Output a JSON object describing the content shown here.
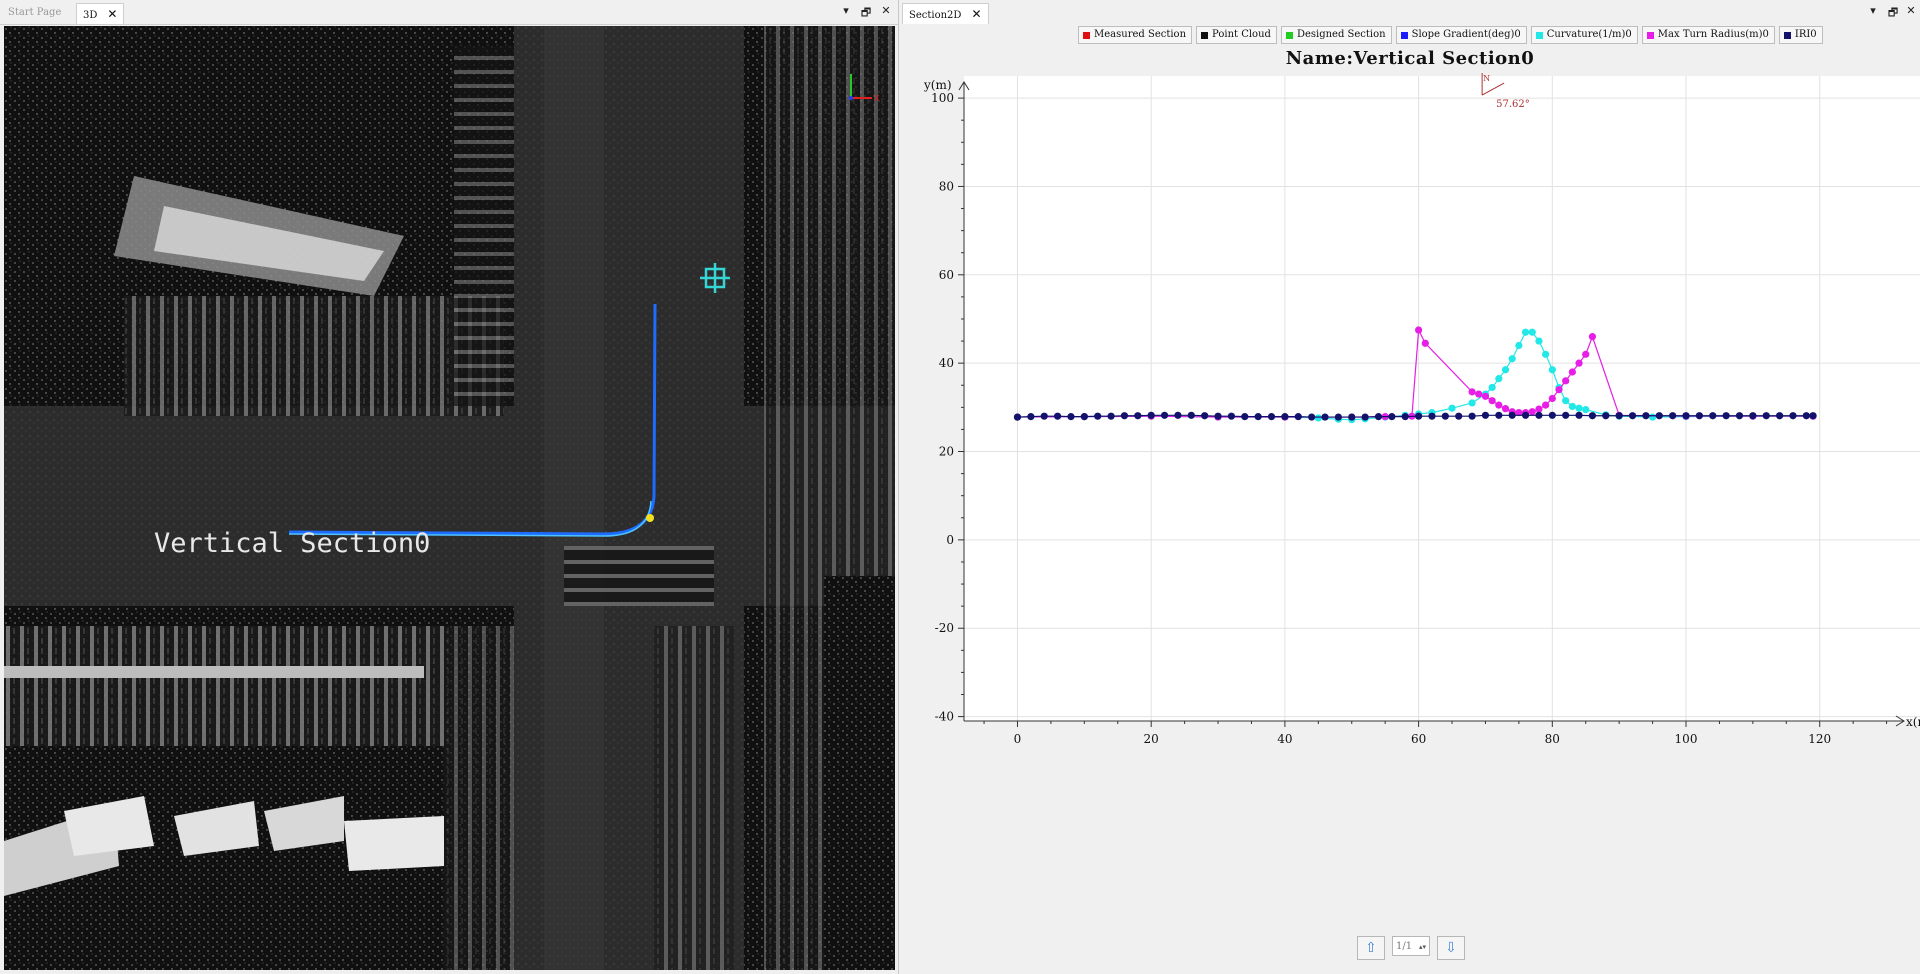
{
  "left_window": {
    "tabs": [
      {
        "label": "Start Page",
        "active": false
      },
      {
        "label": "3D",
        "active": true
      }
    ],
    "controls": {
      "pin": "▾",
      "restore": "🗗",
      "close": "✕"
    },
    "viewport": {
      "section_label": "Vertical Section0",
      "axis_gizmo": {
        "x_label": "X"
      },
      "colors": {
        "section_path": "#1e6cff",
        "crosshair": "#34d6d6",
        "marker": "#f0e020"
      }
    }
  },
  "right_window": {
    "tabs": [
      {
        "label": "Section2D",
        "active": true
      }
    ],
    "controls": {
      "pin": "▾",
      "restore": "🗗",
      "close": "✕"
    },
    "legend": [
      {
        "label": "Measured Section",
        "color": "#e01010"
      },
      {
        "label": "Point Cloud",
        "color": "#111111"
      },
      {
        "label": "Designed Section",
        "color": "#22cc22"
      },
      {
        "label": "Slope Gradient(deg)0",
        "color": "#1a1aff"
      },
      {
        "label": "Curvature(1/m)0",
        "color": "#22e8e8"
      },
      {
        "label": "Max Turn Radius(m)0",
        "color": "#e61ee6"
      },
      {
        "label": "IRI0",
        "color": "#12126b"
      }
    ],
    "north_indicator": {
      "label": "N",
      "angle": "57.62°"
    },
    "pager": {
      "up_icon": "up-arrow-icon",
      "value": "1/1",
      "down_icon": "down-arrow-icon"
    }
  },
  "chart_data": {
    "type": "scatter",
    "title": "Name:Vertical Section0",
    "xlabel": "x(m)",
    "ylabel": "y(m)",
    "xlim": [
      -8,
      135
    ],
    "ylim": [
      -41,
      105
    ],
    "xticks": [
      0,
      20,
      40,
      60,
      80,
      100,
      120
    ],
    "yticks": [
      -40,
      -20,
      0,
      20,
      40,
      60,
      80,
      100
    ],
    "grid": true,
    "series": [
      {
        "name": "Curvature(1/m)0",
        "color": "#22e8e8",
        "x": [
          0,
          10,
          20,
          30,
          40,
          45,
          48,
          50,
          52,
          55,
          58,
          60,
          62,
          65,
          68,
          70,
          71,
          72,
          73,
          74,
          75,
          76,
          77,
          78,
          79,
          80,
          81,
          82,
          83,
          84,
          85,
          88,
          90,
          95,
          100,
          110,
          119
        ],
        "y": [
          27.8,
          27.9,
          28,
          27.8,
          27.8,
          27.6,
          27.3,
          27.2,
          27.4,
          27.8,
          28.2,
          28.5,
          28.8,
          29.8,
          31,
          33,
          34.5,
          36.5,
          38.5,
          41,
          44,
          47,
          47,
          45,
          42,
          38.5,
          34.5,
          31.5,
          30.2,
          29.8,
          29.5,
          28.3,
          28,
          27.8,
          27.9,
          28,
          28
        ]
      },
      {
        "name": "Max Turn Radius(m)0",
        "color": "#e61ee6",
        "x": [
          0,
          10,
          20,
          30,
          40,
          50,
          55,
          59,
          60,
          61,
          68,
          69,
          70,
          71,
          72,
          73,
          74,
          75,
          76,
          77,
          78,
          79,
          80,
          81,
          82,
          83,
          84,
          85,
          86,
          90,
          100,
          110,
          119
        ],
        "y": [
          27.8,
          27.9,
          28,
          27.8,
          27.8,
          27.8,
          27.9,
          28,
          47.5,
          44.5,
          33.5,
          33,
          32.5,
          31.5,
          30.5,
          29.7,
          29,
          28.8,
          28.8,
          29,
          29.6,
          30.5,
          32,
          34,
          36,
          38,
          40,
          42,
          46,
          28.2,
          28,
          28,
          28
        ]
      },
      {
        "name": "IRI0",
        "color": "#12126b",
        "x": [
          0,
          2,
          4,
          6,
          8,
          10,
          12,
          14,
          16,
          18,
          20,
          22,
          24,
          26,
          28,
          30,
          32,
          34,
          36,
          38,
          40,
          42,
          44,
          46,
          48,
          50,
          52,
          54,
          56,
          58,
          60,
          62,
          64,
          66,
          68,
          70,
          72,
          74,
          76,
          78,
          80,
          82,
          84,
          86,
          88,
          90,
          92,
          94,
          96,
          98,
          100,
          102,
          104,
          106,
          108,
          110,
          112,
          114,
          116,
          118,
          119
        ],
        "y": [
          27.8,
          27.9,
          28,
          28,
          27.9,
          27.9,
          28,
          28,
          28.1,
          28.1,
          28.2,
          28.2,
          28.2,
          28.2,
          28.1,
          28,
          28,
          27.9,
          27.9,
          27.9,
          27.9,
          27.9,
          27.8,
          27.8,
          27.8,
          27.8,
          27.8,
          27.9,
          27.9,
          27.9,
          28,
          28,
          28,
          28,
          28,
          28.2,
          28.2,
          28.2,
          28.2,
          28.2,
          28.2,
          28.2,
          28.2,
          28.1,
          28.1,
          28.1,
          28.1,
          28.1,
          28.1,
          28.1,
          28.1,
          28.1,
          28.1,
          28.1,
          28.1,
          28.1,
          28.1,
          28.1,
          28.1,
          28.1,
          28.1
        ]
      }
    ]
  }
}
